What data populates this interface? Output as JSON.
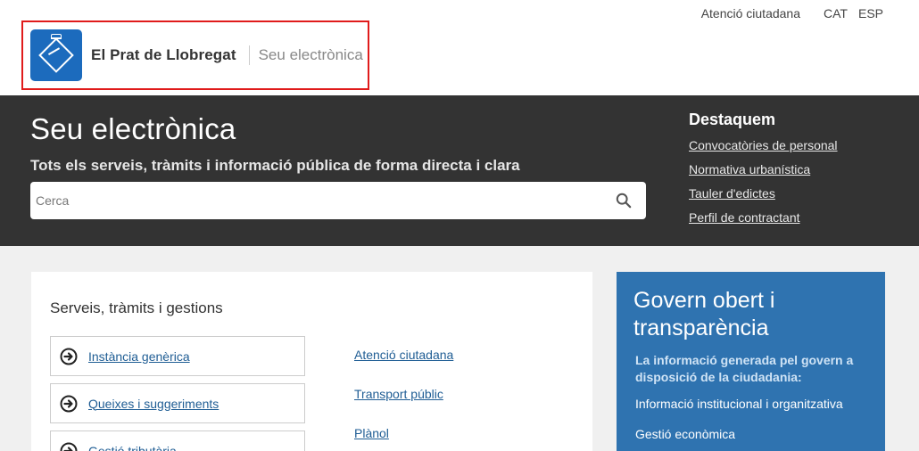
{
  "header": {
    "links": {
      "atencio": "Atenció ciutadana",
      "cat": "CAT",
      "esp": "ESP"
    },
    "logo": {
      "name": "El Prat de Llobregat",
      "subtitle": "Seu electrònica"
    }
  },
  "hero": {
    "title": "Seu electrònica",
    "subtitle": "Tots els serveis, tràmits i informació pública de forma directa i clara",
    "search": {
      "placeholder": "Cerca",
      "value": ""
    },
    "destaquem": {
      "title": "Destaquem",
      "items": [
        "Convocatòries de personal",
        "Normativa urbanística",
        "Tauler d'edictes",
        "Perfil de contractant"
      ]
    }
  },
  "services": {
    "title": "Serveis, tràmits i gestions",
    "items": [
      "Instància genèrica",
      "Queixes i suggeriments",
      "Gestió tributària"
    ],
    "links": [
      "Atenció ciutadana",
      "Transport públic",
      "Plànol"
    ]
  },
  "govern": {
    "title": "Govern obert i transparència",
    "description": "La informació generada pel govern a disposició de la ciudadania:",
    "items": [
      "Informació institucional i organitzativa",
      "Gestió econòmica"
    ]
  },
  "colors": {
    "brand_blue": "#1c6bbd",
    "hero_bg": "#333333",
    "govern_bg": "#2f73b0",
    "link": "#1f5d94",
    "highlight_border": "#e01b1b"
  }
}
